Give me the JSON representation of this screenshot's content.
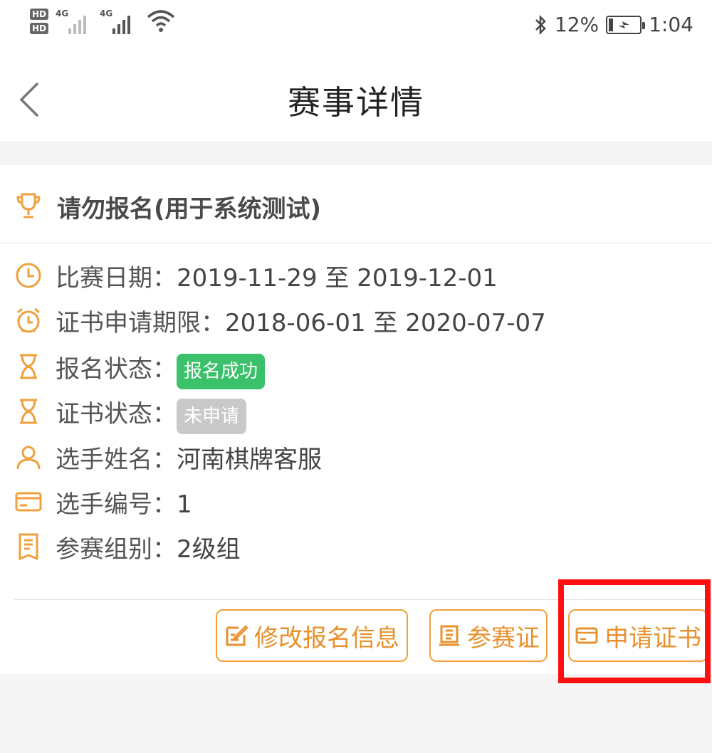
{
  "status_bar": {
    "sim1": "HD",
    "sim2": "HD",
    "net1": "4G",
    "net2": "4G",
    "battery": "12%",
    "time": "1:04"
  },
  "nav": {
    "title": "赛事详情"
  },
  "event": {
    "title": "请勿报名(用于系统测试)",
    "rows": [
      {
        "label": "比赛日期：",
        "value": "2019-11-29 至 2019-12-01",
        "icon": "clock-icon"
      },
      {
        "label": "证书申请期限：",
        "value": "2018-06-01 至 2020-07-07",
        "icon": "alarm-clock-icon"
      },
      {
        "label": "报名状态：",
        "value": "报名成功",
        "icon": "hourglass-icon",
        "badge_color": "#3bc16a"
      },
      {
        "label": "证书状态：",
        "value": "未申请",
        "icon": "hourglass-icon",
        "badge_color": "#c9c9c9"
      },
      {
        "label": "选手姓名：",
        "value": "河南棋牌客服",
        "icon": "person-icon"
      },
      {
        "label": "选手编号：",
        "value": "1",
        "icon": "card-icon"
      },
      {
        "label": "参赛组别：",
        "value": "2级组",
        "icon": "document-icon"
      }
    ]
  },
  "actions": {
    "edit_label": "修改报名信息",
    "pass_label": "参赛证",
    "certificate_label": "申请证书"
  },
  "colors": {
    "accent": "#f0a03c",
    "success": "#3bc16a",
    "highlight": "#ff1010"
  }
}
